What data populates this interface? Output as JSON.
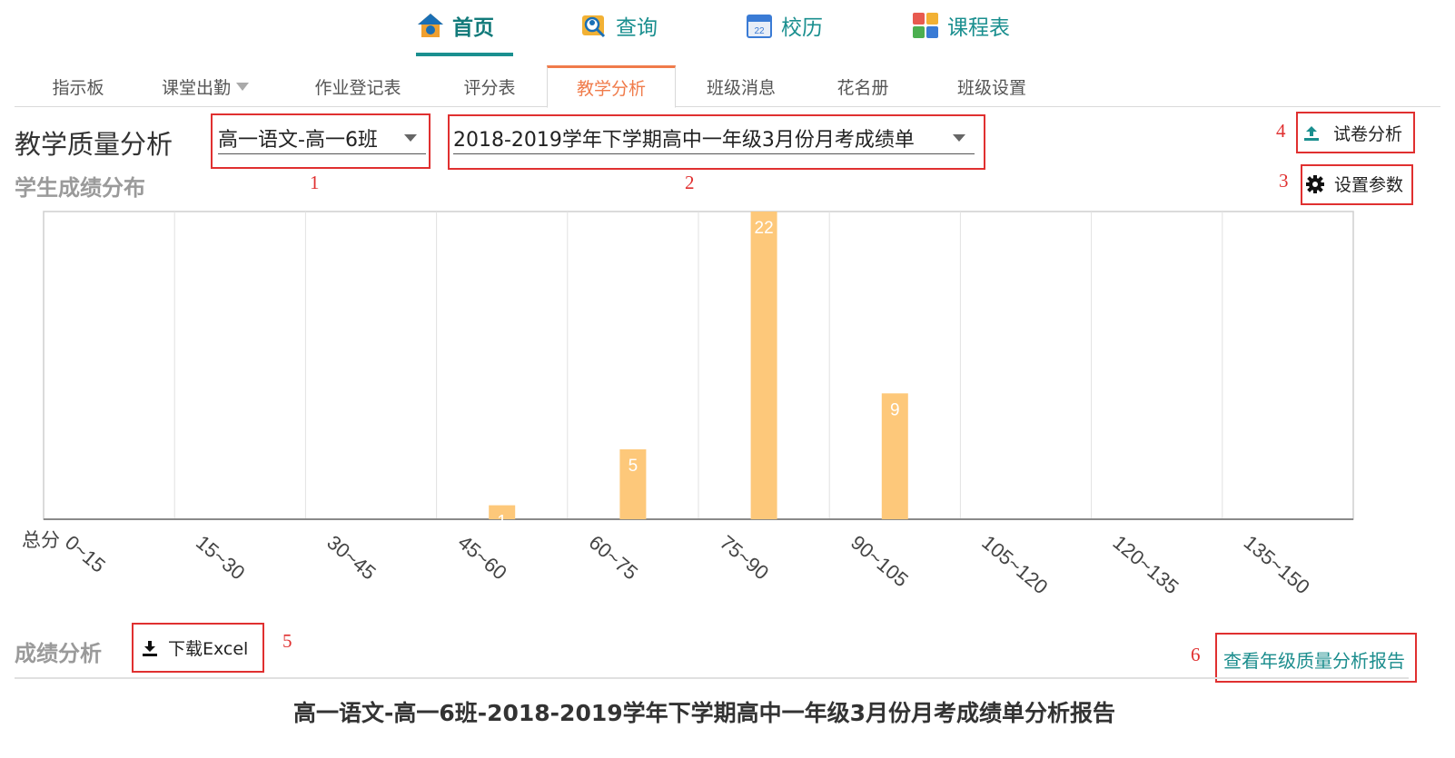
{
  "topnav": {
    "items": [
      {
        "label": "首页",
        "icon": "home-icon"
      },
      {
        "label": "查询",
        "icon": "search-person-icon"
      },
      {
        "label": "校历",
        "icon": "calendar-icon"
      },
      {
        "label": "课程表",
        "icon": "schedule-icon"
      }
    ],
    "active": "首页"
  },
  "subtabs": {
    "items": [
      "指示板",
      "课堂出勤",
      "作业登记表",
      "评分表",
      "教学分析",
      "班级消息",
      "花名册",
      "班级设置"
    ],
    "active": "教学分析"
  },
  "page": {
    "title": "教学质量分析",
    "class_select": "高一语文-高一6班",
    "exam_select": "2018-2019学年下学期高中一年级3月份月考成绩单",
    "paper_analysis_label": "试卷分析",
    "settings_label": "设置参数",
    "distribution_title": "学生成绩分布",
    "score_analysis_title": "成绩分析",
    "download_label": "下载Excel",
    "grade_report_link": "查看年级质量分析报告",
    "report_title": "高一语文-高一6班-2018-2019学年下学期高中一年级3月份月考成绩单分析报告"
  },
  "annotations": [
    "1",
    "2",
    "3",
    "4",
    "5",
    "6"
  ],
  "colors": {
    "accent": "#1a8f8f",
    "active_tab": "#f07b4a",
    "bar": "#fdc87a",
    "annotation": "#e03030"
  },
  "chart_data": {
    "type": "bar",
    "xlabel": "总分",
    "categories": [
      "0~15",
      "15~30",
      "30~45",
      "45~60",
      "60~75",
      "75~90",
      "90~105",
      "105~120",
      "120~135",
      "135~150"
    ],
    "values": [
      0,
      0,
      0,
      1,
      5,
      22,
      9,
      0,
      0,
      0
    ],
    "ylim": [
      0,
      22
    ],
    "grid": true
  }
}
